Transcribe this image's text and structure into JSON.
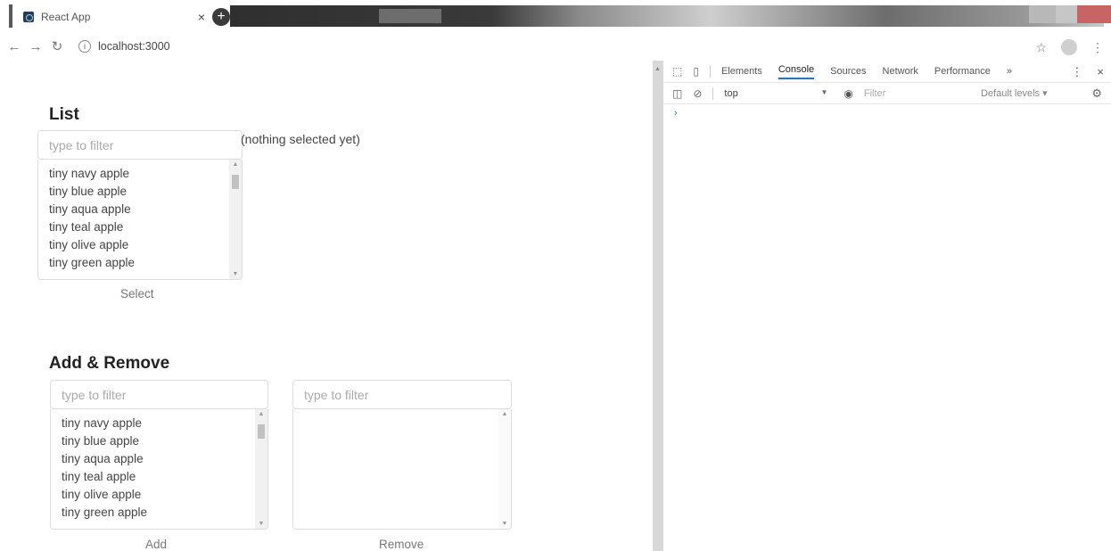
{
  "browser": {
    "tab_title": "React App",
    "tab_close": "×",
    "new_tab": "+",
    "url": "localhost:3000",
    "icons": {
      "back": "arrow-left-icon",
      "forward": "arrow-right-icon",
      "reload": "reload-icon",
      "info": "info-icon",
      "star": "star-icon",
      "profile": "profile-icon",
      "menu": "kebab-menu-icon"
    }
  },
  "list_section": {
    "title": "List",
    "filter_placeholder": "type to filter",
    "items": [
      "tiny navy apple",
      "tiny blue apple",
      "tiny aqua apple",
      "tiny teal apple",
      "tiny olive apple",
      "tiny green apple"
    ],
    "status": "(nothing selected yet)",
    "select_label": "Select"
  },
  "add_remove_section": {
    "title": "Add & Remove",
    "left_filter_placeholder": "type to filter",
    "right_filter_placeholder": "type to filter",
    "left_items": [
      "tiny navy apple",
      "tiny blue apple",
      "tiny aqua apple",
      "tiny teal apple",
      "tiny olive apple",
      "tiny green apple"
    ],
    "add_label": "Add",
    "remove_label": "Remove"
  },
  "devtools": {
    "tabs": [
      "Elements",
      "Console",
      "Sources",
      "Network",
      "Performance"
    ],
    "active_tab": "Console",
    "more_tabs": "»",
    "context": "top",
    "filter_placeholder": "Filter",
    "levels": "Default levels ▾",
    "prompt": "›"
  }
}
